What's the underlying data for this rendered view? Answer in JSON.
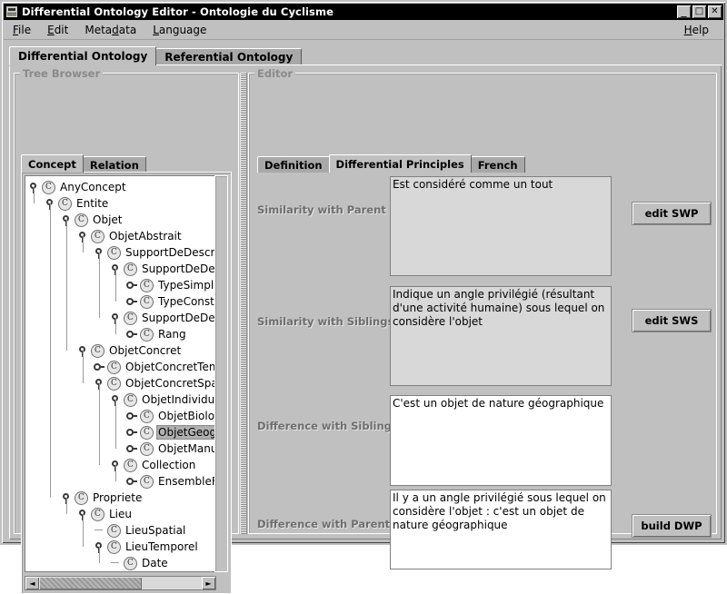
{
  "window": {
    "title": "Differential Ontology Editor - Ontologie du Cyclisme",
    "icon": "app-icon",
    "buttons": {
      "minimize": "_",
      "maximize": "□",
      "close": "✕"
    }
  },
  "menubar": {
    "items": [
      {
        "label": "File",
        "mnemonic": "F"
      },
      {
        "label": "Edit",
        "mnemonic": "E"
      },
      {
        "label": "Metadata",
        "mnemonic": "d"
      },
      {
        "label": "Language",
        "mnemonic": "L"
      }
    ],
    "help": {
      "label": "Help",
      "mnemonic": "H"
    }
  },
  "tabs": [
    {
      "label": "Differential Ontology",
      "selected": true
    },
    {
      "label": "Referential Ontology",
      "selected": false
    }
  ],
  "tree_browser": {
    "title": "Tree Browser",
    "tabs": [
      {
        "label": "Concept",
        "selected": true
      },
      {
        "label": "Relation",
        "selected": false
      }
    ],
    "nodes": [
      {
        "label": "AnyConcept",
        "depth": 0,
        "state": "expanded",
        "icon": "C",
        "selected": false
      },
      {
        "label": "Entite",
        "depth": 1,
        "state": "expanded",
        "icon": "C",
        "selected": false
      },
      {
        "label": "Objet",
        "depth": 2,
        "state": "expanded",
        "icon": "C",
        "selected": false
      },
      {
        "label": "ObjetAbstrait",
        "depth": 3,
        "state": "expanded",
        "icon": "C",
        "selected": false
      },
      {
        "label": "SupportDeDescription",
        "depth": 4,
        "state": "expanded",
        "icon": "C",
        "selected": false
      },
      {
        "label": "SupportDeDescriptionType",
        "depth": 5,
        "state": "expanded",
        "icon": "C",
        "selected": false
      },
      {
        "label": "TypeSimple",
        "depth": 6,
        "state": "collapsed",
        "icon": "C",
        "selected": false
      },
      {
        "label": "TypeConstruit",
        "depth": 6,
        "state": "collapsed",
        "icon": "C",
        "selected": false
      },
      {
        "label": "SupportDeDescriptionRang",
        "depth": 5,
        "state": "expanded",
        "icon": "C",
        "selected": false
      },
      {
        "label": "Rang",
        "depth": 6,
        "state": "collapsed",
        "icon": "C",
        "selected": false
      },
      {
        "label": "ObjetConcret",
        "depth": 3,
        "state": "expanded",
        "icon": "C",
        "selected": false
      },
      {
        "label": "ObjetConcretTemporel",
        "depth": 4,
        "state": "collapsed",
        "icon": "C",
        "selected": false
      },
      {
        "label": "ObjetConcretSpatial",
        "depth": 4,
        "state": "expanded",
        "icon": "C",
        "selected": false
      },
      {
        "label": "ObjetIndividuel",
        "depth": 5,
        "state": "expanded",
        "icon": "C",
        "selected": false
      },
      {
        "label": "ObjetBiologique",
        "depth": 6,
        "state": "collapsed",
        "icon": "C",
        "selected": false
      },
      {
        "label": "ObjetGeographique",
        "depth": 6,
        "state": "collapsed",
        "icon": "C",
        "selected": true
      },
      {
        "label": "ObjetManufacture",
        "depth": 6,
        "state": "collapsed",
        "icon": "C",
        "selected": false
      },
      {
        "label": "Collection",
        "depth": 5,
        "state": "expanded",
        "icon": "C",
        "selected": false
      },
      {
        "label": "EnsembleFini",
        "depth": 6,
        "state": "collapsed",
        "icon": "C",
        "selected": false
      },
      {
        "label": "Propriete",
        "depth": 2,
        "state": "expanded",
        "icon": "C",
        "selected": false
      },
      {
        "label": "Lieu",
        "depth": 3,
        "state": "expanded",
        "icon": "C",
        "selected": false
      },
      {
        "label": "LieuSpatial",
        "depth": 4,
        "state": "leaf",
        "icon": "C",
        "selected": false
      },
      {
        "label": "LieuTemporel",
        "depth": 4,
        "state": "expanded",
        "icon": "C",
        "selected": false
      },
      {
        "label": "Date",
        "depth": 5,
        "state": "leaf",
        "icon": "C",
        "selected": false
      }
    ],
    "hscrollbar": {
      "left_arrow": "◄",
      "right_arrow": "►"
    }
  },
  "editor": {
    "title": "Editor",
    "tabs": [
      {
        "label": "Definition",
        "selected": false
      },
      {
        "label": "Differential Principles",
        "selected": true
      },
      {
        "label": "French",
        "selected": false
      }
    ],
    "rows": [
      {
        "label": "Similarity with Parent :",
        "value": "Est considéré comme un tout",
        "editable": false,
        "button": "edit SWP"
      },
      {
        "label": "Similarity with Siblings :",
        "value": "Indique un angle privilégié (résultant d'une activité humaine) sous lequel on considère l'objet",
        "editable": false,
        "button": "edit SWS"
      },
      {
        "label": "Difference with Siblings :",
        "value": "C'est un objet de nature géographique",
        "editable": true,
        "button": ""
      },
      {
        "label": "Difference with Parent :",
        "value": "Il y a un angle privilégié sous lequel on considère l'objet : c'est un objet de nature géographique",
        "editable": true,
        "button": "build DWP"
      }
    ]
  },
  "colors": {
    "window_bg": "#c0c0c0",
    "titlebar_bg": "#000000",
    "titlebar_fg": "#ffffff",
    "tab_selected": "#c0c0c0",
    "tab_unselected": "#a8a8a8",
    "label_fg": "#6e6e6e",
    "field_readonly": "#d8d8d8",
    "field_editable": "#ffffff"
  }
}
